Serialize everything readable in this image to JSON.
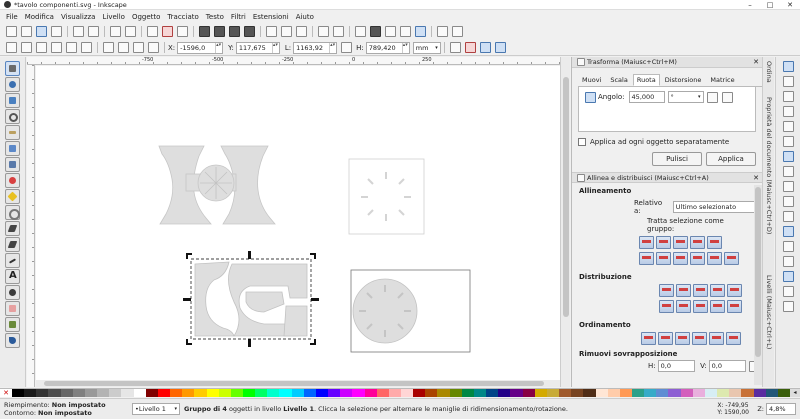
{
  "window": {
    "title": "*tavolo componenti.svg - Inkscape"
  },
  "menu": [
    "File",
    "Modifica",
    "Visualizza",
    "Livello",
    "Oggetto",
    "Tracciato",
    "Testo",
    "Filtri",
    "Estensioni",
    "Aiuto"
  ],
  "selector_toolbar": {
    "x_label": "X:",
    "x_value": "-1596,0",
    "y_label": "Y:",
    "y_value": "117,675",
    "w_label": "L:",
    "w_value": "1163,92",
    "h_label": "H:",
    "h_value": "789,420",
    "unit": "mm"
  },
  "ruler": {
    "ticks": [
      "-750",
      "-500",
      "-250",
      "0",
      "250"
    ]
  },
  "transform_panel": {
    "title": "Trasforma (Maiusc+Ctrl+M)",
    "tabs": [
      "Muovi",
      "Scala",
      "Ruota",
      "Distorsione",
      "Matrice"
    ],
    "active_tab": "Ruota",
    "angle_label": "Angolo:",
    "angle_value": "45,000",
    "angle_unit": "°",
    "apply_separately": "Applica ad ogni oggetto separatamente",
    "clear_button": "Pulisci",
    "apply_button": "Applica"
  },
  "align_panel": {
    "title": "Allinea e distribuisci (Maiusc+Ctrl+A)",
    "section_align": "Allineamento",
    "relative_label": "Relativo a:",
    "relative_value": "Ultimo selezionato",
    "treat_group": "Tratta selezione come gruppo:",
    "section_distribute": "Distribuzione",
    "section_order": "Ordinamento",
    "section_overlap": "Rimuovi sovrapposizione",
    "h_label": "H:",
    "h_value": "0,0",
    "v_label": "V:",
    "v_value": "0,0"
  },
  "side_tabs": [
    "Ordina",
    "Proprietà del documento (Maiusc+Ctrl+D)",
    "Livelli (Maiusc+Ctrl+L)"
  ],
  "palette": [
    "#000000",
    "#1a1a1a",
    "#333333",
    "#4d4d4d",
    "#666666",
    "#808080",
    "#999999",
    "#b3b3b3",
    "#cccccc",
    "#e6e6e6",
    "#ffffff",
    "#800000",
    "#ff0000",
    "#ff6600",
    "#ff9900",
    "#ffcc00",
    "#ffff00",
    "#ccff00",
    "#66ff00",
    "#00ff00",
    "#00ff66",
    "#00ffcc",
    "#00ffff",
    "#00ccff",
    "#0066ff",
    "#0000ff",
    "#6600ff",
    "#cc00ff",
    "#ff00ff",
    "#ff0099",
    "#ff6666",
    "#ffaaaa",
    "#ffd5d5",
    "#aa0000",
    "#aa4400",
    "#aa8800",
    "#668800",
    "#008844",
    "#008888",
    "#004488",
    "#220088",
    "#660088",
    "#880044",
    "#d4aa00",
    "#c8ab37",
    "#a05a2c",
    "#784421",
    "#502d16",
    "#ffe6d5",
    "#ffccaa",
    "#ff9955",
    "#2ca089",
    "#37abc8",
    "#5f8dd3",
    "#8d5fd3",
    "#d35fbc",
    "#e9afdd",
    "#d7eef4",
    "#dde9af",
    "#e9c6af",
    "#c87137",
    "#5a2ca0",
    "#215778",
    "#3a5f0b"
  ],
  "status": {
    "fill_label": "Riempimento:",
    "fill_value": "Non impostato",
    "stroke_label": "Contorno:",
    "stroke_value": "Non impostato",
    "layer": "•Livello 1",
    "message_prefix": "Gruppo di ",
    "message_count": "4",
    "message_mid": " oggetti in livello ",
    "message_layer": "Livello 1",
    "message_suffix": ". Clicca la selezione per alternare le maniglie di ridimensionamento/rotazione.",
    "coord_x": "X: -749,95",
    "coord_y": "Y: 1590,00",
    "zoom_label": "Z:",
    "zoom_value": "4,8%"
  }
}
